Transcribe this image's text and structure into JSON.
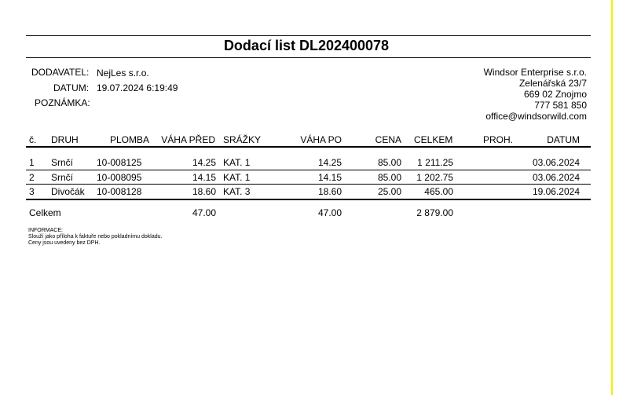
{
  "title": "Dodací list DL202400078",
  "header": {
    "supplier_label": "DODAVATEL:",
    "supplier_value": "NejLes s.r.o.",
    "date_label": "DATUM:",
    "date_value": "19.07.2024 6:19:49",
    "note_label": "POZNÁMKA:",
    "note_value": ""
  },
  "recipient": {
    "name": "Windsor Enterprise s.r.o.",
    "street": "Zelenářská 23/7",
    "city": "669 02 Znojmo",
    "phone": "777 581 850",
    "email": "office@windsorwild.com"
  },
  "table": {
    "columns": [
      "č.",
      "DRUH",
      "PLOMBA",
      "VÁHA PŘED",
      "SRÁŽKY",
      "VÁHA PO",
      "CENA",
      "CELKEM",
      "PROH.",
      "DATUM"
    ],
    "rows": [
      [
        "1",
        "Srnčí",
        "10-008125",
        "14.25",
        "KAT. 1",
        "14.25",
        "85.00",
        "1 211.25",
        "",
        "03.06.2024"
      ],
      [
        "2",
        "Srnčí",
        "10-008095",
        "14.15",
        "KAT. 1",
        "14.15",
        "85.00",
        "1 202.75",
        "",
        "03.06.2024"
      ],
      [
        "3",
        "Divočák",
        "10-008128",
        "18.60",
        "KAT. 3",
        "18.60",
        "25.00",
        "465.00",
        "",
        "19.06.2024"
      ]
    ],
    "totals": {
      "label": "Celkem",
      "weight_before": "47.00",
      "weight_after": "47.00",
      "total": "2 879.00"
    }
  },
  "info": {
    "heading": "INFORMACE:",
    "line1": "Slouží jako příloha k faktuře nebo pokladnímu dokladu.",
    "line2": "Ceny jsou uvedeny bez DPH."
  }
}
